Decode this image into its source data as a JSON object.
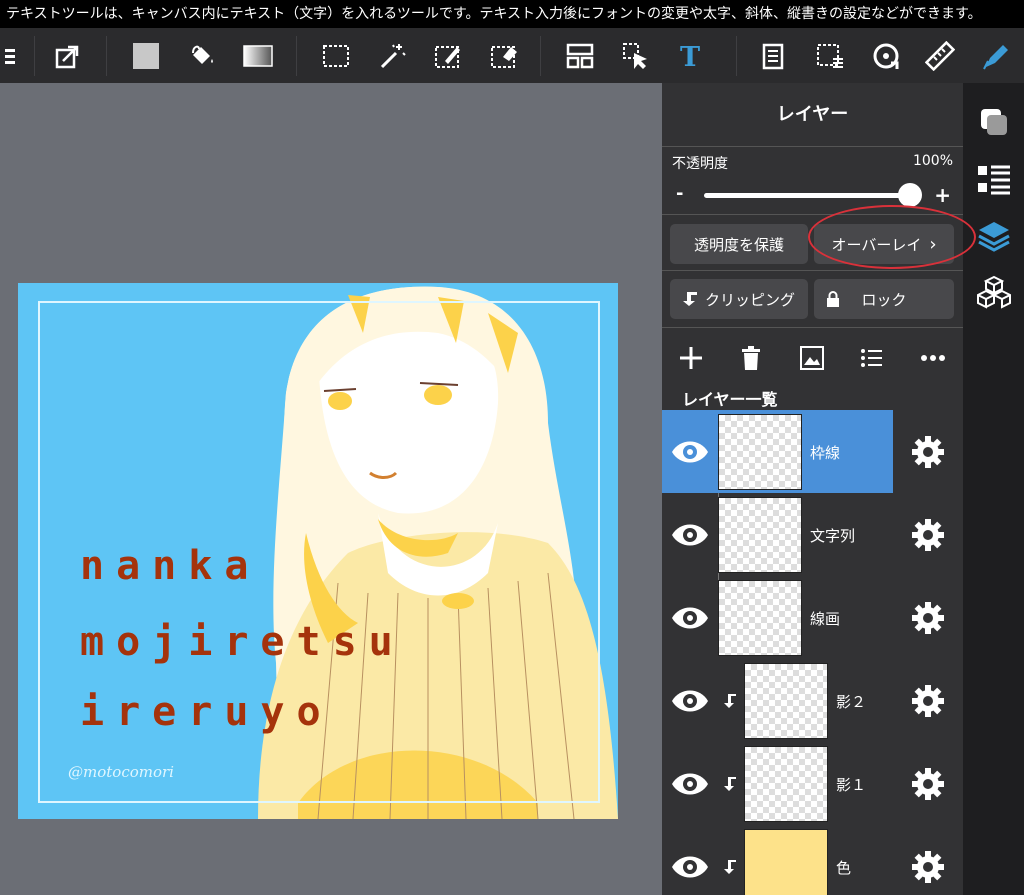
{
  "caption": "テキストツールは、キャンバス内にテキスト（文字）を入れるツールです。テキスト入力後にフォントの変更や太字、斜体、縦書きの設定などができます。",
  "artwork": {
    "lines": [
      "nanka",
      "mojiretsu",
      "ireruyo"
    ],
    "signature": "@motocomori"
  },
  "panel": {
    "title": "レイヤー",
    "opacity_label": "不透明度",
    "opacity_value": "100%",
    "opacity_level": 1.0,
    "minus": "-",
    "plus": "+",
    "protect_alpha": "透明度を保護",
    "blend_mode": "オーバーレイ",
    "clipping": "クリッピング",
    "lock": "ロック",
    "list_label": "レイヤー一覧",
    "layers": [
      {
        "name": "枠線",
        "selected": true,
        "clipped": false
      },
      {
        "name": "文字列",
        "selected": false,
        "clipped": false
      },
      {
        "name": "線画",
        "selected": false,
        "clipped": false
      },
      {
        "name": "影２",
        "selected": false,
        "clipped": true
      },
      {
        "name": "影１",
        "selected": false,
        "clipped": true
      },
      {
        "name": "色",
        "selected": false,
        "clipped": true
      }
    ]
  },
  "colors": {
    "accent": "#4a90d9",
    "text_tool": "#3b9bd6",
    "artwork_bg": "#5ec5f5",
    "annotation": "#d9313a"
  }
}
